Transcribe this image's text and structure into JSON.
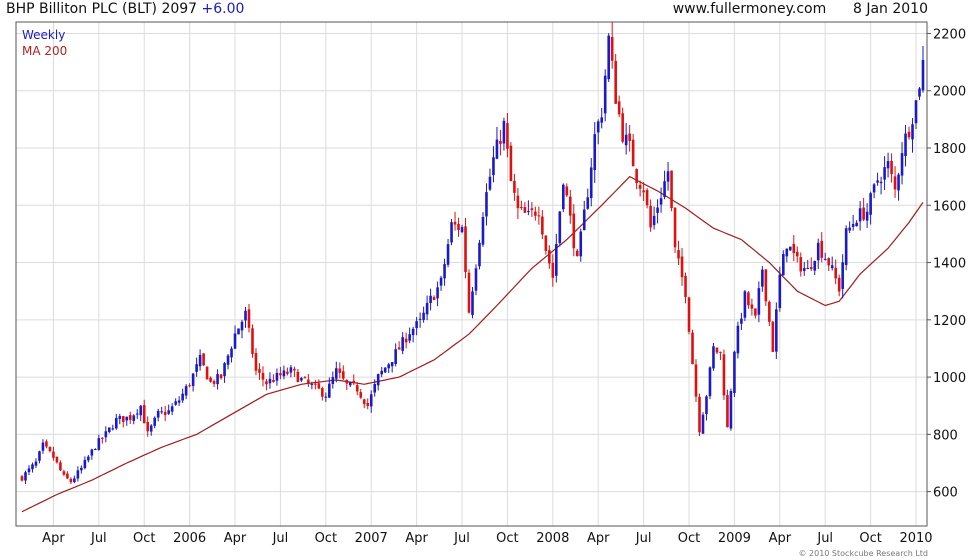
{
  "header": {
    "company": "BHP Billiton PLC (BLT)",
    "price": "2097",
    "change": "+6.00",
    "website": "www.fullermoney.com",
    "date": "8 Jan 2010"
  },
  "legend": {
    "series1": "Weekly",
    "series2": "MA 200"
  },
  "copyright": "© 2010 Stockcube Research Ltd",
  "colors": {
    "up": "#1a1acc",
    "down": "#e01010",
    "ma": "#a01c1c",
    "grid": "#dcdcdc",
    "frame": "#555555"
  },
  "chart_data": {
    "type": "candlestick",
    "frequency": "weekly",
    "ylim": [
      480,
      2240
    ],
    "grid": true,
    "y_ticks": [
      "600",
      "800",
      "1000",
      "1200",
      "1400",
      "1600",
      "1800",
      "2000",
      "2200"
    ],
    "y_tick_values": [
      600,
      800,
      1000,
      1200,
      1400,
      1600,
      1800,
      2000,
      2200
    ],
    "x_ticks": [
      "Apr",
      "Jul",
      "Oct",
      "2006",
      "Apr",
      "Jul",
      "Oct",
      "2007",
      "Apr",
      "Jul",
      "Oct",
      "2008",
      "Apr",
      "Jul",
      "Oct",
      "2009",
      "Apr",
      "Jul",
      "Oct",
      "2010"
    ],
    "x_tick_weeks": [
      9,
      22,
      35,
      48,
      61,
      74,
      87,
      100,
      113,
      126,
      139,
      152,
      165,
      178,
      191,
      204,
      217,
      230,
      243,
      256
    ],
    "price_keypoints": [
      [
        0,
        650
      ],
      [
        4,
        700
      ],
      [
        6,
        760
      ],
      [
        9,
        720
      ],
      [
        12,
        650
      ],
      [
        14,
        635
      ],
      [
        17,
        680
      ],
      [
        21,
        760
      ],
      [
        24,
        800
      ],
      [
        27,
        850
      ],
      [
        31,
        860
      ],
      [
        34,
        900
      ],
      [
        36,
        800
      ],
      [
        39,
        870
      ],
      [
        42,
        880
      ],
      [
        45,
        920
      ],
      [
        48,
        980
      ],
      [
        51,
        1060
      ],
      [
        54,
        980
      ],
      [
        57,
        1000
      ],
      [
        61,
        1150
      ],
      [
        64,
        1220
      ],
      [
        67,
        1020
      ],
      [
        70,
        980
      ],
      [
        73,
        1000
      ],
      [
        77,
        1020
      ],
      [
        80,
        990
      ],
      [
        84,
        960
      ],
      [
        87,
        940
      ],
      [
        90,
        1020
      ],
      [
        93,
        970
      ],
      [
        96,
        960
      ],
      [
        99,
        900
      ],
      [
        102,
        1000
      ],
      [
        105,
        1050
      ],
      [
        108,
        1100
      ],
      [
        111,
        1160
      ],
      [
        114,
        1190
      ],
      [
        117,
        1270
      ],
      [
        120,
        1330
      ],
      [
        123,
        1530
      ],
      [
        126,
        1520
      ],
      [
        128,
        1230
      ],
      [
        130,
        1400
      ],
      [
        132,
        1580
      ],
      [
        135,
        1760
      ],
      [
        138,
        1880
      ],
      [
        140,
        1680
      ],
      [
        142,
        1580
      ],
      [
        145,
        1560
      ],
      [
        148,
        1590
      ],
      [
        150,
        1450
      ],
      [
        152,
        1350
      ],
      [
        155,
        1700
      ],
      [
        157,
        1550
      ],
      [
        159,
        1400
      ],
      [
        162,
        1650
      ],
      [
        164,
        1840
      ],
      [
        166,
        1930
      ],
      [
        168,
        2180
      ],
      [
        170,
        1980
      ],
      [
        172,
        1850
      ],
      [
        174,
        1800
      ],
      [
        176,
        1700
      ],
      [
        178,
        1660
      ],
      [
        180,
        1520
      ],
      [
        182,
        1600
      ],
      [
        185,
        1720
      ],
      [
        187,
        1440
      ],
      [
        190,
        1300
      ],
      [
        192,
        1050
      ],
      [
        194,
        820
      ],
      [
        196,
        940
      ],
      [
        198,
        1100
      ],
      [
        200,
        1080
      ],
      [
        202,
        820
      ],
      [
        204,
        1100
      ],
      [
        207,
        1280
      ],
      [
        210,
        1200
      ],
      [
        212,
        1380
      ],
      [
        215,
        1100
      ],
      [
        217,
        1350
      ],
      [
        219,
        1470
      ],
      [
        222,
        1400
      ],
      [
        225,
        1370
      ],
      [
        228,
        1460
      ],
      [
        231,
        1400
      ],
      [
        234,
        1310
      ],
      [
        236,
        1500
      ],
      [
        239,
        1560
      ],
      [
        242,
        1580
      ],
      [
        245,
        1690
      ],
      [
        248,
        1740
      ],
      [
        250,
        1650
      ],
      [
        252,
        1800
      ],
      [
        254,
        1870
      ],
      [
        256,
        1960
      ],
      [
        258,
        2097
      ]
    ],
    "ma200_keypoints": [
      [
        0,
        530
      ],
      [
        10,
        590
      ],
      [
        20,
        640
      ],
      [
        30,
        700
      ],
      [
        40,
        755
      ],
      [
        50,
        800
      ],
      [
        60,
        870
      ],
      [
        70,
        940
      ],
      [
        80,
        975
      ],
      [
        90,
        990
      ],
      [
        98,
        975
      ],
      [
        108,
        1000
      ],
      [
        118,
        1060
      ],
      [
        128,
        1150
      ],
      [
        136,
        1250
      ],
      [
        146,
        1380
      ],
      [
        156,
        1480
      ],
      [
        166,
        1600
      ],
      [
        174,
        1700
      ],
      [
        182,
        1650
      ],
      [
        190,
        1590
      ],
      [
        198,
        1520
      ],
      [
        206,
        1480
      ],
      [
        214,
        1400
      ],
      [
        222,
        1300
      ],
      [
        230,
        1250
      ],
      [
        234,
        1265
      ],
      [
        240,
        1360
      ],
      [
        248,
        1450
      ],
      [
        254,
        1540
      ],
      [
        258,
        1610
      ]
    ]
  }
}
